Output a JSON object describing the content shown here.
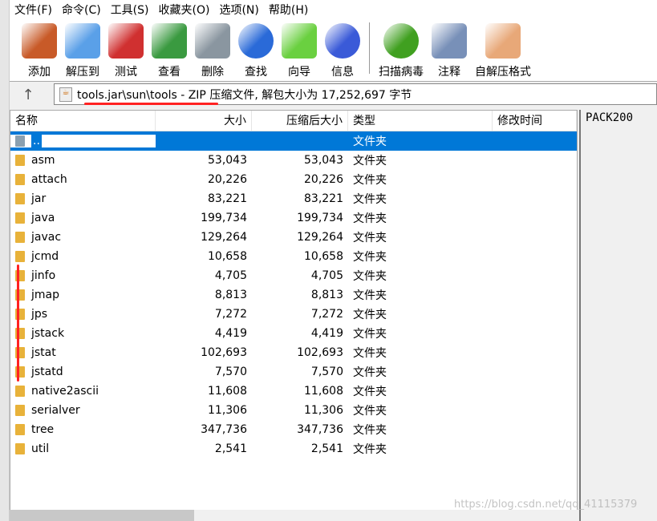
{
  "menu": [
    "文件(F)",
    "命令(C)",
    "工具(S)",
    "收藏夹(O)",
    "选项(N)",
    "帮助(H)"
  ],
  "toolbar": [
    {
      "label": "添加",
      "icon": "add-archive-icon",
      "color": "#c85a28"
    },
    {
      "label": "解压到",
      "icon": "extract-folder-icon",
      "color": "#5aa0e8"
    },
    {
      "label": "测试",
      "icon": "test-clipboard-icon",
      "color": "#d03030"
    },
    {
      "label": "查看",
      "icon": "view-book-icon",
      "color": "#3a9a40"
    },
    {
      "label": "删除",
      "icon": "trash-icon",
      "color": "#8a96a0"
    },
    {
      "label": "查找",
      "icon": "magnifier-icon",
      "color": "#2a6ad8"
    },
    {
      "label": "向导",
      "icon": "wizard-wand-icon",
      "color": "#6ad040"
    },
    {
      "label": "信息",
      "icon": "info-icon",
      "color": "#3a5ad8"
    },
    {
      "label": "扫描病毒",
      "icon": "virus-scan-icon",
      "color": "#40a020"
    },
    {
      "label": "注释",
      "icon": "comment-icon",
      "color": "#7890b8"
    },
    {
      "label": "自解压格式",
      "icon": "sfx-box-icon",
      "color": "#e8a878"
    }
  ],
  "address": "tools.jar\\sun\\tools - ZIP 压缩文件, 解包大小为 17,252,697 字节",
  "columns": [
    "名称",
    "大小",
    "压缩后大小",
    "类型",
    "修改时间"
  ],
  "rows": [
    {
      "name": "..",
      "size": "",
      "packed": "",
      "type": "文件夹"
    },
    {
      "name": "asm",
      "size": "53,043",
      "packed": "53,043",
      "type": "文件夹"
    },
    {
      "name": "attach",
      "size": "20,226",
      "packed": "20,226",
      "type": "文件夹"
    },
    {
      "name": "jar",
      "size": "83,221",
      "packed": "83,221",
      "type": "文件夹"
    },
    {
      "name": "java",
      "size": "199,734",
      "packed": "199,734",
      "type": "文件夹"
    },
    {
      "name": "javac",
      "size": "129,264",
      "packed": "129,264",
      "type": "文件夹"
    },
    {
      "name": "jcmd",
      "size": "10,658",
      "packed": "10,658",
      "type": "文件夹"
    },
    {
      "name": "jinfo",
      "size": "4,705",
      "packed": "4,705",
      "type": "文件夹"
    },
    {
      "name": "jmap",
      "size": "8,813",
      "packed": "8,813",
      "type": "文件夹"
    },
    {
      "name": "jps",
      "size": "7,272",
      "packed": "7,272",
      "type": "文件夹"
    },
    {
      "name": "jstack",
      "size": "4,419",
      "packed": "4,419",
      "type": "文件夹"
    },
    {
      "name": "jstat",
      "size": "102,693",
      "packed": "102,693",
      "type": "文件夹"
    },
    {
      "name": "jstatd",
      "size": "7,570",
      "packed": "7,570",
      "type": "文件夹"
    },
    {
      "name": "native2ascii",
      "size": "11,608",
      "packed": "11,608",
      "type": "文件夹"
    },
    {
      "name": "serialver",
      "size": "11,306",
      "packed": "11,306",
      "type": "文件夹"
    },
    {
      "name": "tree",
      "size": "347,736",
      "packed": "347,736",
      "type": "文件夹"
    },
    {
      "name": "util",
      "size": "2,541",
      "packed": "2,541",
      "type": "文件夹"
    }
  ],
  "comment": "PACK200",
  "watermark": "https://blog.csdn.net/qq_41115379",
  "selected_color": "#0078d7"
}
